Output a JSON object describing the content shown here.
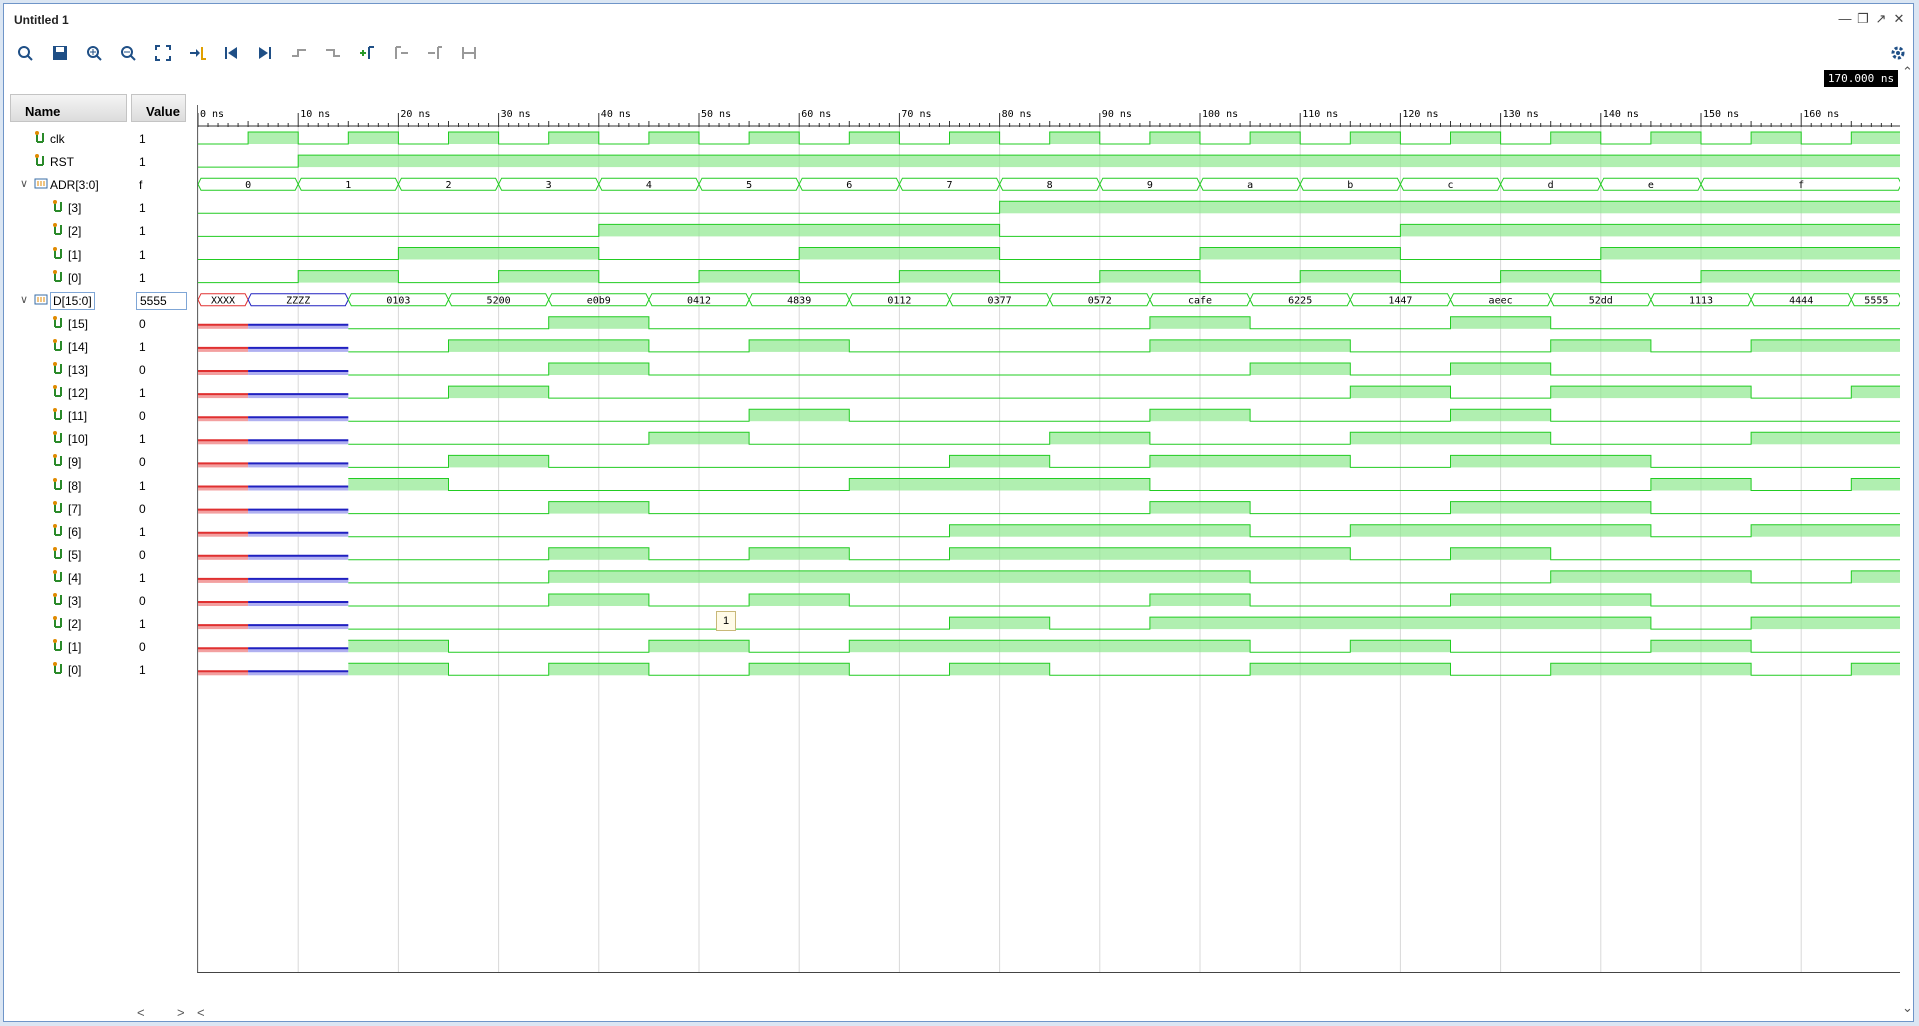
{
  "window": {
    "title": "Untitled 1"
  },
  "toolbar": {
    "icons": [
      "search-icon",
      "save-icon",
      "zoom-in-icon",
      "zoom-out-icon",
      "zoom-fit-icon",
      "goto-cursor-icon",
      "go-to-start-icon",
      "go-to-end-icon",
      "previous-transition-icon",
      "next-transition-icon",
      "add-marker-icon",
      "previous-marker-icon",
      "next-marker-icon",
      "swap-cursors-icon"
    ],
    "settings_icon": "gear-icon"
  },
  "columns": {
    "name": "Name",
    "value": "Value"
  },
  "cursor_time": "170.000 ns",
  "cursor_tag": "1",
  "time_axis": {
    "labels": [
      "0 ns",
      "10 ns",
      "20 ns",
      "30 ns",
      "40 ns",
      "50 ns",
      "60 ns",
      "70 ns",
      "80 ns",
      "90 ns",
      "100 ns",
      "110 ns",
      "120 ns",
      "130 ns",
      "140 ns",
      "150 ns",
      "160 ns"
    ]
  },
  "signals": [
    {
      "id": "clk",
      "name": "clk",
      "value": "1",
      "type": "bit",
      "indent": 0
    },
    {
      "id": "rst",
      "name": "RST",
      "value": "1",
      "type": "bit",
      "indent": 0
    },
    {
      "id": "adr",
      "name": "ADR[3:0]",
      "value": "f",
      "type": "bus",
      "indent": 0,
      "expanded": true
    },
    {
      "id": "adr3",
      "name": "[3]",
      "value": "1",
      "type": "bit",
      "indent": 1
    },
    {
      "id": "adr2",
      "name": "[2]",
      "value": "1",
      "type": "bit",
      "indent": 1
    },
    {
      "id": "adr1",
      "name": "[1]",
      "value": "1",
      "type": "bit",
      "indent": 1
    },
    {
      "id": "adr0",
      "name": "[0]",
      "value": "1",
      "type": "bit",
      "indent": 1
    },
    {
      "id": "d",
      "name": "D[15:0]",
      "value": "5555",
      "type": "bus",
      "indent": 0,
      "expanded": true,
      "selected": true
    },
    {
      "id": "d15",
      "name": "[15]",
      "value": "0",
      "type": "bit",
      "indent": 1
    },
    {
      "id": "d14",
      "name": "[14]",
      "value": "1",
      "type": "bit",
      "indent": 1
    },
    {
      "id": "d13",
      "name": "[13]",
      "value": "0",
      "type": "bit",
      "indent": 1
    },
    {
      "id": "d12",
      "name": "[12]",
      "value": "1",
      "type": "bit",
      "indent": 1
    },
    {
      "id": "d11",
      "name": "[11]",
      "value": "0",
      "type": "bit",
      "indent": 1
    },
    {
      "id": "d10",
      "name": "[10]",
      "value": "1",
      "type": "bit",
      "indent": 1
    },
    {
      "id": "d9",
      "name": "[9]",
      "value": "0",
      "type": "bit",
      "indent": 1
    },
    {
      "id": "d8",
      "name": "[8]",
      "value": "1",
      "type": "bit",
      "indent": 1
    },
    {
      "id": "d7",
      "name": "[7]",
      "value": "0",
      "type": "bit",
      "indent": 1
    },
    {
      "id": "d6",
      "name": "[6]",
      "value": "1",
      "type": "bit",
      "indent": 1
    },
    {
      "id": "d5",
      "name": "[5]",
      "value": "0",
      "type": "bit",
      "indent": 1
    },
    {
      "id": "d4",
      "name": "[4]",
      "value": "1",
      "type": "bit",
      "indent": 1
    },
    {
      "id": "d3",
      "name": "[3]",
      "value": "0",
      "type": "bit",
      "indent": 1
    },
    {
      "id": "d2",
      "name": "[2]",
      "value": "1",
      "type": "bit",
      "indent": 1
    },
    {
      "id": "d1",
      "name": "[1]",
      "value": "0",
      "type": "bit",
      "indent": 1
    },
    {
      "id": "d0",
      "name": "[0]",
      "value": "1",
      "type": "bit",
      "indent": 1
    }
  ],
  "waves": {
    "clk_period_ns": 10,
    "rst_release_ns": 10,
    "adr_values": [
      "0",
      "1",
      "2",
      "3",
      "4",
      "5",
      "6",
      "7",
      "8",
      "9",
      "a",
      "b",
      "c",
      "d",
      "e",
      "f"
    ],
    "d_values": [
      "XXXX",
      "ZZZZ",
      "0103",
      "5200",
      "e0b9",
      "0412",
      "4839",
      "0112",
      "0377",
      "0572",
      "cafe",
      "6225",
      "1447",
      "aeec",
      "52dd",
      "1113",
      "4444",
      "5555"
    ],
    "d_start_ns": [
      0,
      5,
      15,
      25,
      35,
      45,
      55,
      65,
      75,
      85,
      95,
      105,
      115,
      125,
      135,
      145,
      155,
      165
    ]
  },
  "colors": {
    "wave": "#22cc22",
    "wave_fill": "#8fe88f",
    "x_color": "#e03030",
    "z_color": "#2020c0"
  }
}
